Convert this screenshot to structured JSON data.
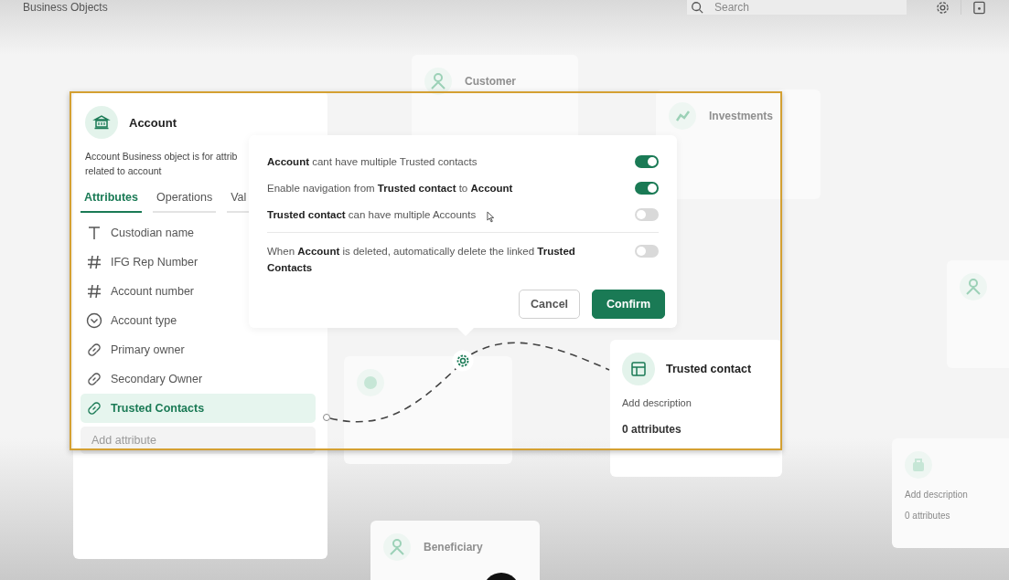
{
  "header": {
    "title": "Business Objects",
    "search": {
      "placeholder": "Search"
    }
  },
  "background_nodes": [
    {
      "kind": "person",
      "title": "Customer"
    },
    {
      "kind": "chart",
      "title": "Investments"
    },
    {
      "kind": "person"
    },
    {
      "kind": "globe"
    },
    {
      "kind": "bag",
      "description": "Add description",
      "attributes": "0 attributes"
    },
    {
      "kind": "person",
      "title": "Beneficiary"
    }
  ],
  "account_card": {
    "title": "Account",
    "description": "Account Business object is for attrib\nrelated to account",
    "tabs": [
      {
        "label": "Attributes",
        "selected": true
      },
      {
        "label": "Operations",
        "selected": false
      },
      {
        "label": "Val",
        "selected": false
      }
    ],
    "attributes": [
      {
        "kind": "text",
        "name": "Custodian name",
        "selected": false
      },
      {
        "kind": "number",
        "name": "IFG Rep Number",
        "selected": false
      },
      {
        "kind": "number",
        "name": "Account number",
        "selected": false
      },
      {
        "kind": "choice",
        "name": "Account type",
        "selected": false
      },
      {
        "kind": "link",
        "name": "Primary owner",
        "selected": false
      },
      {
        "kind": "link",
        "name": "Secondary Owner",
        "selected": false
      },
      {
        "kind": "link",
        "name": "Trusted Contacts",
        "selected": true
      }
    ],
    "add_attribute": {
      "placeholder": "Add attribute"
    }
  },
  "relation_popup": {
    "option_groups": [
      [
        {
          "text": "**Account** cant have multiple Trusted contacts",
          "on": true
        },
        {
          "text": "Enable navigation from **Trusted contact** to **Account**",
          "on": true
        },
        {
          "text": "**Trusted contact** can have multiple Accounts",
          "on": false
        }
      ],
      [
        {
          "text": "When **Account** is deleted, automatically delete the linked **Trusted Contacts**",
          "on": false
        }
      ]
    ],
    "buttons": [
      {
        "kind": "secondary",
        "label": "Cancel"
      },
      {
        "kind": "primary",
        "label": "Confirm"
      }
    ]
  },
  "target_card": {
    "title": "Trusted contact",
    "description": "Add description",
    "attributes": "0 attributes"
  }
}
